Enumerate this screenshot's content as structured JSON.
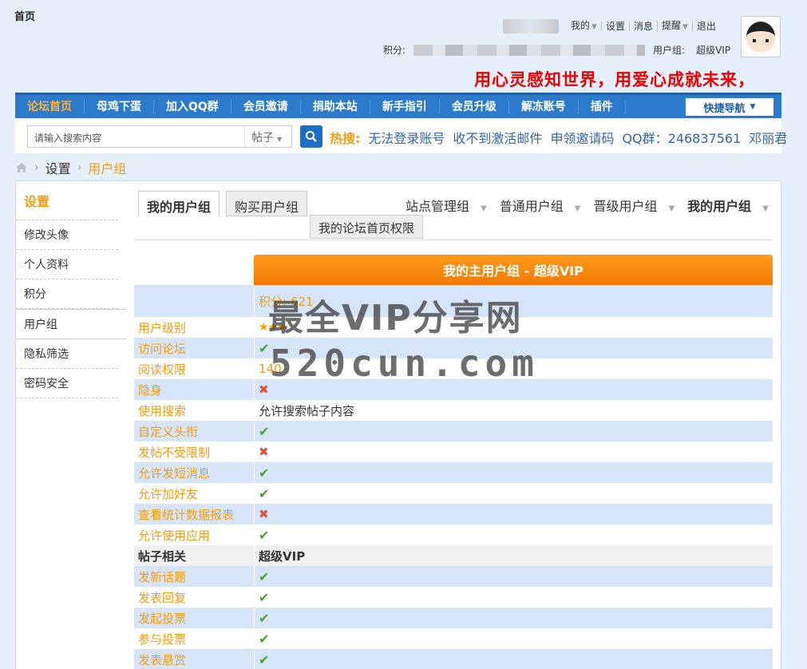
{
  "header": {
    "home_title": "首页",
    "user_menu": [
      {
        "label": "我的",
        "has_arrow": true
      },
      {
        "label": "设置",
        "has_arrow": false
      },
      {
        "label": "消息",
        "has_arrow": false
      },
      {
        "label": "提醒",
        "has_arrow": true
      },
      {
        "label": "退出",
        "has_arrow": false
      }
    ],
    "points_label": "积分:",
    "usergroup_label": "用户组:",
    "usergroup_value": "超级VIP",
    "slogan": "用心灵感知世界，用爱心成就未来，"
  },
  "nav": {
    "items": [
      "论坛首页",
      "母鸡下蛋",
      "加入QQ群",
      "会员邀请",
      "捐助本站",
      "新手指引",
      "会员升级",
      "解冻账号",
      "插件"
    ],
    "quick_nav": "快捷导航"
  },
  "search": {
    "placeholder": "请输入搜索内容",
    "type": "帖子",
    "hot_label": "热搜:",
    "hot_links": [
      "无法登录账号",
      "收不到激活邮件",
      "申领邀请码",
      "QQ群：246837561",
      "邓丽君"
    ]
  },
  "breadcrumb": {
    "items": [
      "设置",
      "用户组"
    ]
  },
  "sidebar": {
    "title": "设置",
    "items": [
      "修改头像",
      "个人资料",
      "积分",
      "用户组",
      "隐私筛选",
      "密码安全"
    ]
  },
  "tabs": {
    "my_group": "我的用户组",
    "buy_group": "购买用户组",
    "home_perm": "我的论坛首页权限",
    "group_nav": [
      {
        "label": "站点管理组",
        "bold": false
      },
      {
        "label": "普通用户组",
        "bold": false
      },
      {
        "label": "晋级用户组",
        "bold": false
      },
      {
        "label": "我的用户组",
        "bold": true
      }
    ]
  },
  "perm_table": {
    "header": "我的主用户组 - 超级VIP",
    "points_text": "积分: 621",
    "rows": [
      {
        "label": "用户级别",
        "value": "★★★",
        "kind": "stars"
      },
      {
        "label": "访问论坛",
        "value": "✔",
        "kind": "ok"
      },
      {
        "label": "阅读权限",
        "value": "140",
        "kind": "yellow"
      },
      {
        "label": "隐身",
        "value": "✖",
        "kind": "no"
      },
      {
        "label": "使用搜索",
        "value": "允许搜索帖子内容",
        "kind": "text"
      },
      {
        "label": "自定义头衔",
        "value": "✔",
        "kind": "ok"
      },
      {
        "label": "发帖不受限制",
        "value": "✖",
        "kind": "no"
      },
      {
        "label": "允许发短消息",
        "value": "✔",
        "kind": "ok"
      },
      {
        "label": "允许加好友",
        "value": "✔",
        "kind": "ok"
      },
      {
        "label": "查看统计数据报表",
        "value": "✖",
        "kind": "no"
      },
      {
        "label": "允许使用应用",
        "value": "✔",
        "kind": "ok"
      }
    ],
    "section_label": "帖子相关",
    "section_value": "超级VIP",
    "post_rows": [
      {
        "label": "发新话题",
        "value": "✔",
        "kind": "ok"
      },
      {
        "label": "发表回复",
        "value": "✔",
        "kind": "ok"
      },
      {
        "label": "发起投票",
        "value": "✔",
        "kind": "ok"
      },
      {
        "label": "参与投票",
        "value": "✔",
        "kind": "ok"
      },
      {
        "label": "发表悬赏",
        "value": "✔",
        "kind": "ok"
      }
    ]
  },
  "watermark": {
    "line1": "最全VIP分享网",
    "line2": "520cun.com"
  }
}
